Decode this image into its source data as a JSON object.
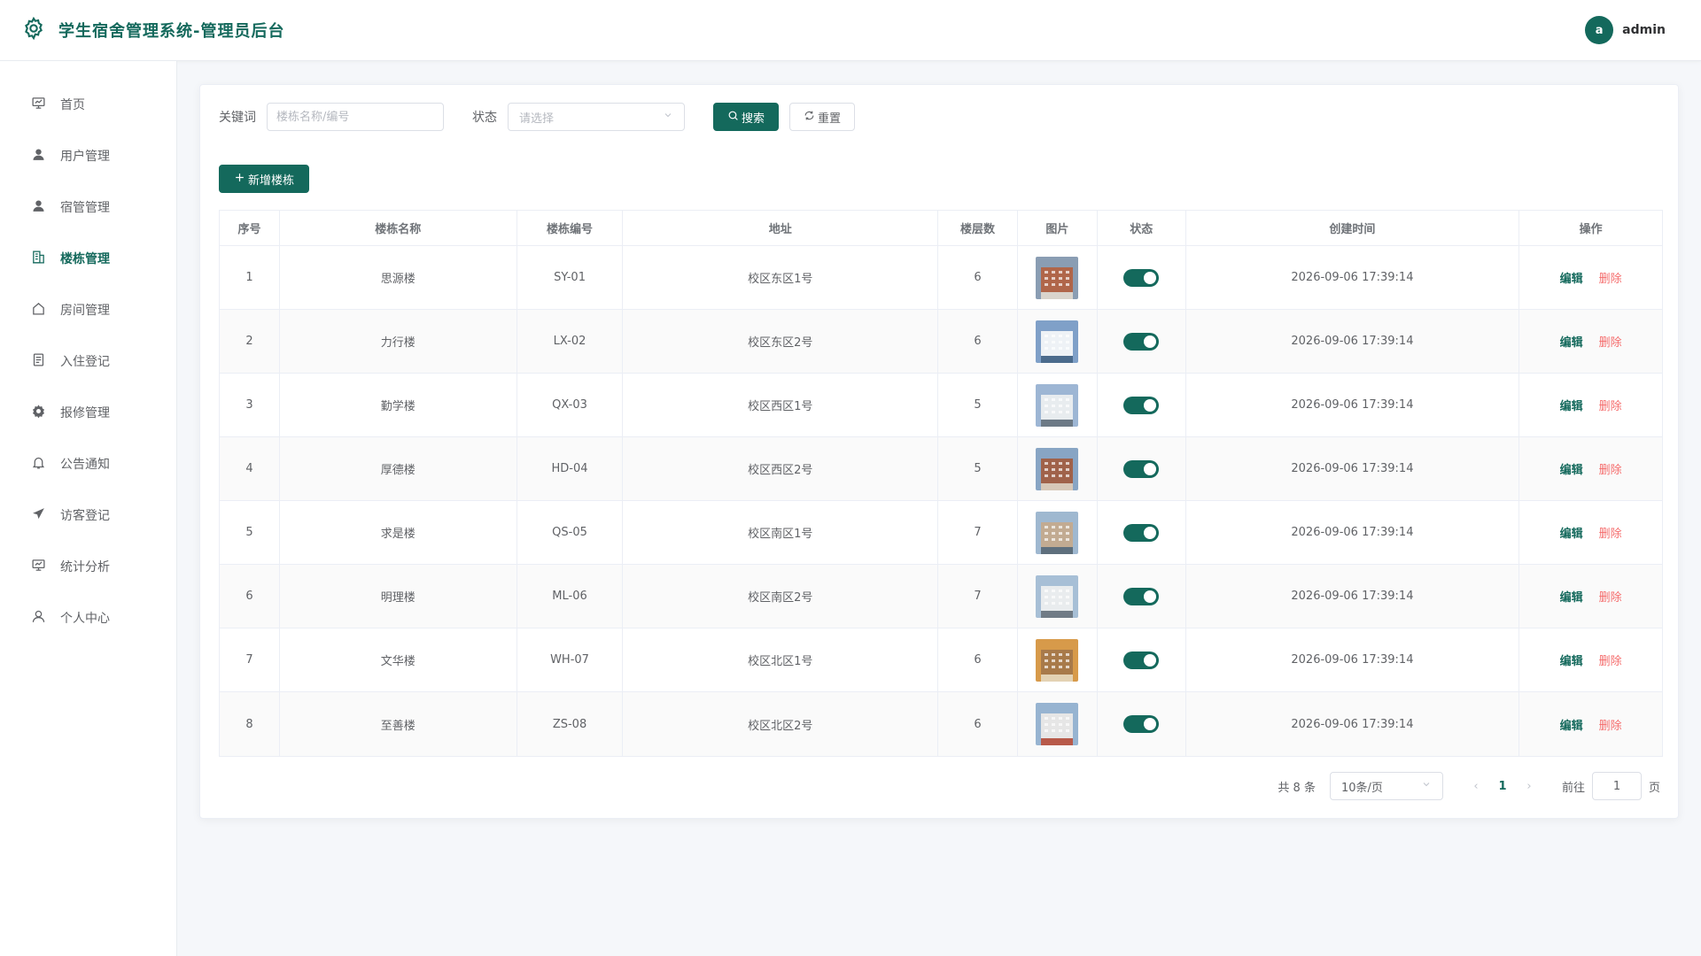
{
  "header": {
    "title": "学生宿舍管理系统-管理员后台",
    "avatar_letter": "a",
    "username": "admin",
    "accent": "#14695c"
  },
  "sidebar": {
    "items": [
      {
        "label": "首页",
        "icon": "dashboard-icon"
      },
      {
        "label": "用户管理",
        "icon": "user-icon"
      },
      {
        "label": "宿管管理",
        "icon": "user-icon"
      },
      {
        "label": "楼栋管理",
        "icon": "building-icon",
        "active": true
      },
      {
        "label": "房间管理",
        "icon": "house-icon"
      },
      {
        "label": "入住登记",
        "icon": "document-icon"
      },
      {
        "label": "报修管理",
        "icon": "gear-icon"
      },
      {
        "label": "公告通知",
        "icon": "bell-icon"
      },
      {
        "label": "访客登记",
        "icon": "send-icon"
      },
      {
        "label": "统计分析",
        "icon": "chart-icon"
      },
      {
        "label": "个人中心",
        "icon": "person-icon"
      }
    ]
  },
  "filters": {
    "keyword_label": "关键词",
    "keyword_placeholder": "楼栋名称/编号",
    "status_label": "状态",
    "status_placeholder": "请选择",
    "search_label": "搜索",
    "reset_label": "重置"
  },
  "toolbar": {
    "add_label": "新增楼栋"
  },
  "table": {
    "columns": [
      "序号",
      "楼栋名称",
      "楼栋编号",
      "地址",
      "楼层数",
      "图片",
      "状态",
      "创建时间",
      "操作"
    ],
    "edit_label": "编辑",
    "delete_label": "删除",
    "rows": [
      {
        "idx": "1",
        "name": "思源楼",
        "code": "SY-01",
        "address": "校区东区1号",
        "floors": "6",
        "status_on": true,
        "created": "2026-09-06 17:39:14"
      },
      {
        "idx": "2",
        "name": "力行楼",
        "code": "LX-02",
        "address": "校区东区2号",
        "floors": "6",
        "status_on": true,
        "created": "2026-09-06 17:39:14"
      },
      {
        "idx": "3",
        "name": "勤学楼",
        "code": "QX-03",
        "address": "校区西区1号",
        "floors": "5",
        "status_on": true,
        "created": "2026-09-06 17:39:14"
      },
      {
        "idx": "4",
        "name": "厚德楼",
        "code": "HD-04",
        "address": "校区西区2号",
        "floors": "5",
        "status_on": true,
        "created": "2026-09-06 17:39:14"
      },
      {
        "idx": "5",
        "name": "求是楼",
        "code": "QS-05",
        "address": "校区南区1号",
        "floors": "7",
        "status_on": true,
        "created": "2026-09-06 17:39:14"
      },
      {
        "idx": "6",
        "name": "明理楼",
        "code": "ML-06",
        "address": "校区南区2号",
        "floors": "7",
        "status_on": true,
        "created": "2026-09-06 17:39:14"
      },
      {
        "idx": "7",
        "name": "文华楼",
        "code": "WH-07",
        "address": "校区北区1号",
        "floors": "6",
        "status_on": true,
        "created": "2026-09-06 17:39:14"
      },
      {
        "idx": "8",
        "name": "至善楼",
        "code": "ZS-08",
        "address": "校区北区2号",
        "floors": "6",
        "status_on": true,
        "created": "2026-09-06 17:39:14"
      }
    ]
  },
  "pagination": {
    "total_text": "共 8 条",
    "page_size": "10条/页",
    "current_page": "1",
    "goto_label": "前往",
    "goto_value": "1",
    "page_suffix": "页"
  }
}
